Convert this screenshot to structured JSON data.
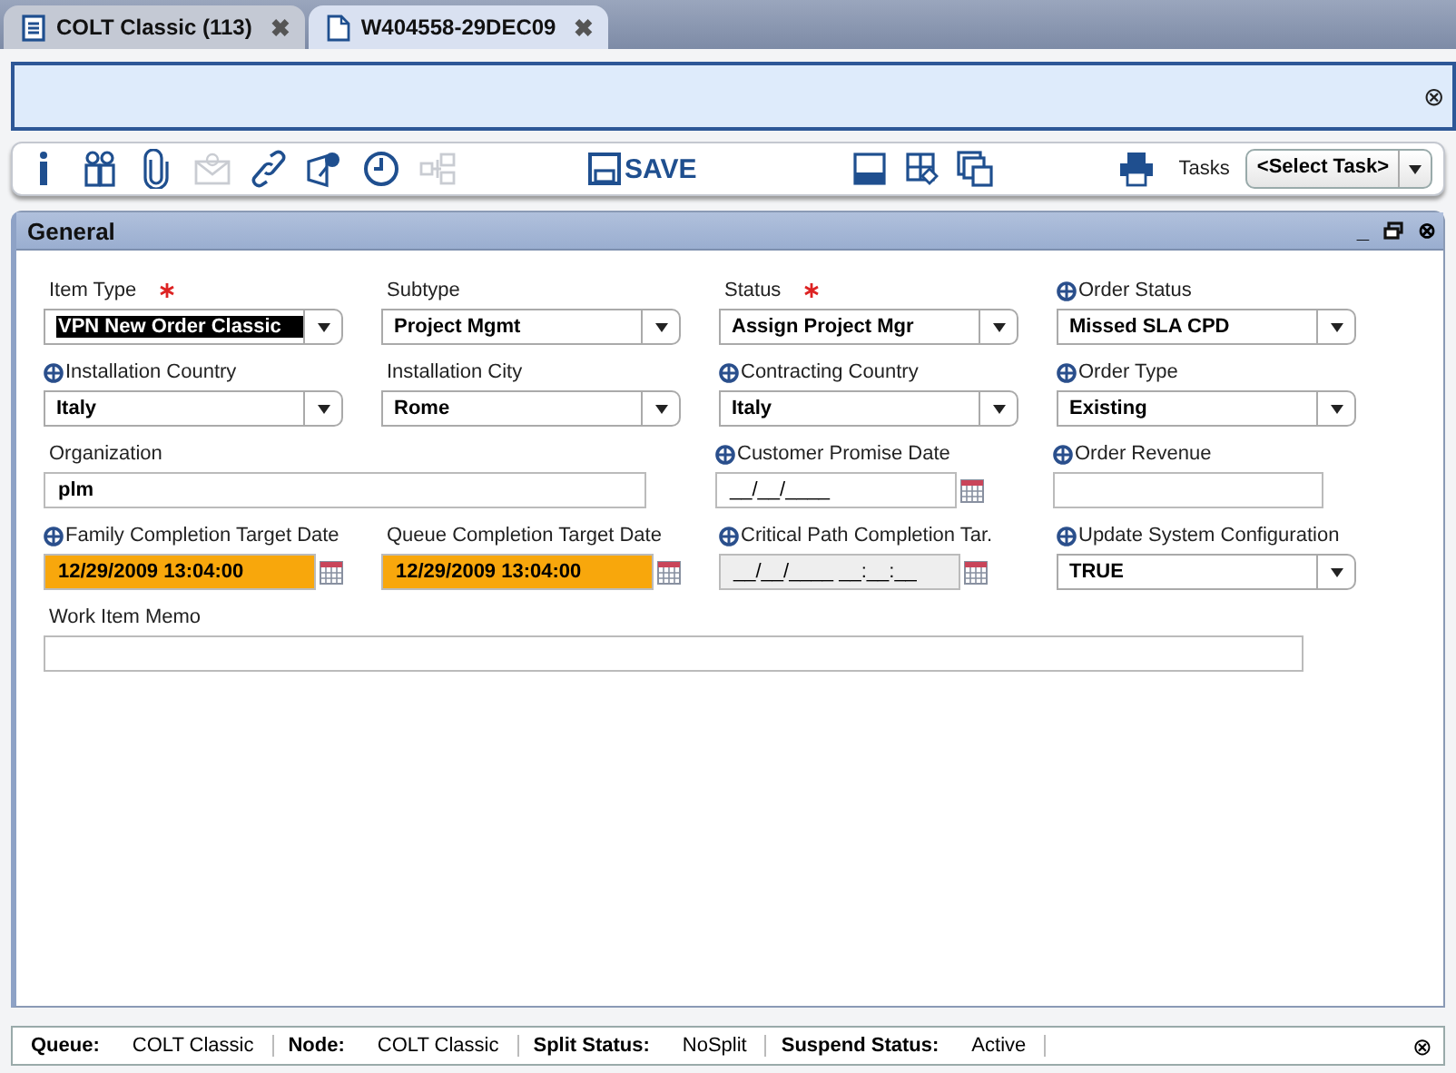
{
  "tabs": [
    {
      "label": "COLT Classic (113)",
      "kind": "list",
      "selected": false,
      "close": "✖"
    },
    {
      "label": "W404558-29DEC09",
      "kind": "doc",
      "selected": true,
      "close": "✖"
    }
  ],
  "message_bar": {
    "close": "⊗"
  },
  "toolbar": {
    "icons": [
      {
        "kind": "info",
        "disabled": false
      },
      {
        "kind": "people",
        "disabled": false
      },
      {
        "kind": "clip",
        "disabled": false
      },
      {
        "kind": "mail",
        "disabled": true
      },
      {
        "kind": "link",
        "disabled": false
      },
      {
        "kind": "tag",
        "disabled": false
      },
      {
        "kind": "clock",
        "disabled": false
      },
      {
        "kind": "tree",
        "disabled": true
      }
    ],
    "save": "SAVE",
    "right_icons": [
      {
        "kind": "panel"
      },
      {
        "kind": "grid"
      },
      {
        "kind": "windows"
      },
      {
        "kind": "print"
      }
    ],
    "tasks_label": "Tasks",
    "task_select": "<Select Task>"
  },
  "panel": {
    "title": "General",
    "controls": [
      "_",
      "⊗"
    ],
    "rows": [
      [
        {
          "kind": "select",
          "label": "Item Type",
          "required": true,
          "globe": false,
          "value": "VPN New Order Classic",
          "selected": true
        },
        {
          "kind": "select",
          "label": "Subtype",
          "required": false,
          "globe": false,
          "value": "Project Mgmt",
          "selected": false
        },
        {
          "kind": "select",
          "label": "Status",
          "required": true,
          "globe": false,
          "value": "Assign Project Mgr",
          "selected": false
        },
        {
          "kind": "select",
          "label": "Order Status",
          "required": false,
          "globe": true,
          "value": "Missed SLA CPD",
          "selected": false
        }
      ],
      [
        {
          "kind": "select",
          "label": "Installation Country",
          "required": false,
          "globe": true,
          "value": "Italy",
          "selected": false
        },
        {
          "kind": "select",
          "label": "Installation City",
          "required": false,
          "globe": false,
          "value": "Rome",
          "selected": false
        },
        {
          "kind": "select",
          "label": "Contracting Country",
          "required": false,
          "globe": true,
          "value": "Italy",
          "selected": false
        },
        {
          "kind": "select",
          "label": "Order Type",
          "required": false,
          "globe": true,
          "value": "Existing",
          "selected": false
        }
      ],
      [
        {
          "kind": "wide",
          "label": "Organization",
          "required": false,
          "globe": false,
          "value": "plm"
        },
        "",
        {
          "kind": "date",
          "label": "Customer Promise Date",
          "required": false,
          "globe": true,
          "value": "__/__/____",
          "flagged": false,
          "disabled": false
        },
        {
          "kind": "text",
          "label": "Order Revenue",
          "required": false,
          "globe": true
        }
      ],
      [
        {
          "kind": "date",
          "label": "Family Completion Target Date",
          "required": false,
          "globe": true,
          "value": "12/29/2009 13:04:00",
          "flagged": true,
          "disabled": false
        },
        {
          "kind": "date",
          "label": "Queue Completion Target Date",
          "required": false,
          "globe": false,
          "value": "12/29/2009 13:04:00",
          "flagged": true,
          "disabled": false
        },
        {
          "kind": "date",
          "label": "Critical Path Completion Tar.",
          "required": false,
          "globe": true,
          "value": "__/__/____ __:__:__",
          "flagged": false,
          "disabled": true
        },
        {
          "kind": "select",
          "label": "Update System Configuration",
          "required": false,
          "globe": true,
          "value": "TRUE",
          "selected": false
        }
      ],
      [
        {
          "kind": "memo",
          "label": "Work Item Memo",
          "required": false,
          "globe": false
        }
      ]
    ]
  },
  "status_bar": {
    "items": [
      {
        "label": "Queue:",
        "value": "COLT Classic"
      },
      {
        "label": "Node:",
        "value": "COLT Classic"
      },
      {
        "label": "Split Status:",
        "value": "NoSplit"
      },
      {
        "label": "Suspend Status:",
        "value": "Active"
      }
    ],
    "close": "⊗"
  }
}
